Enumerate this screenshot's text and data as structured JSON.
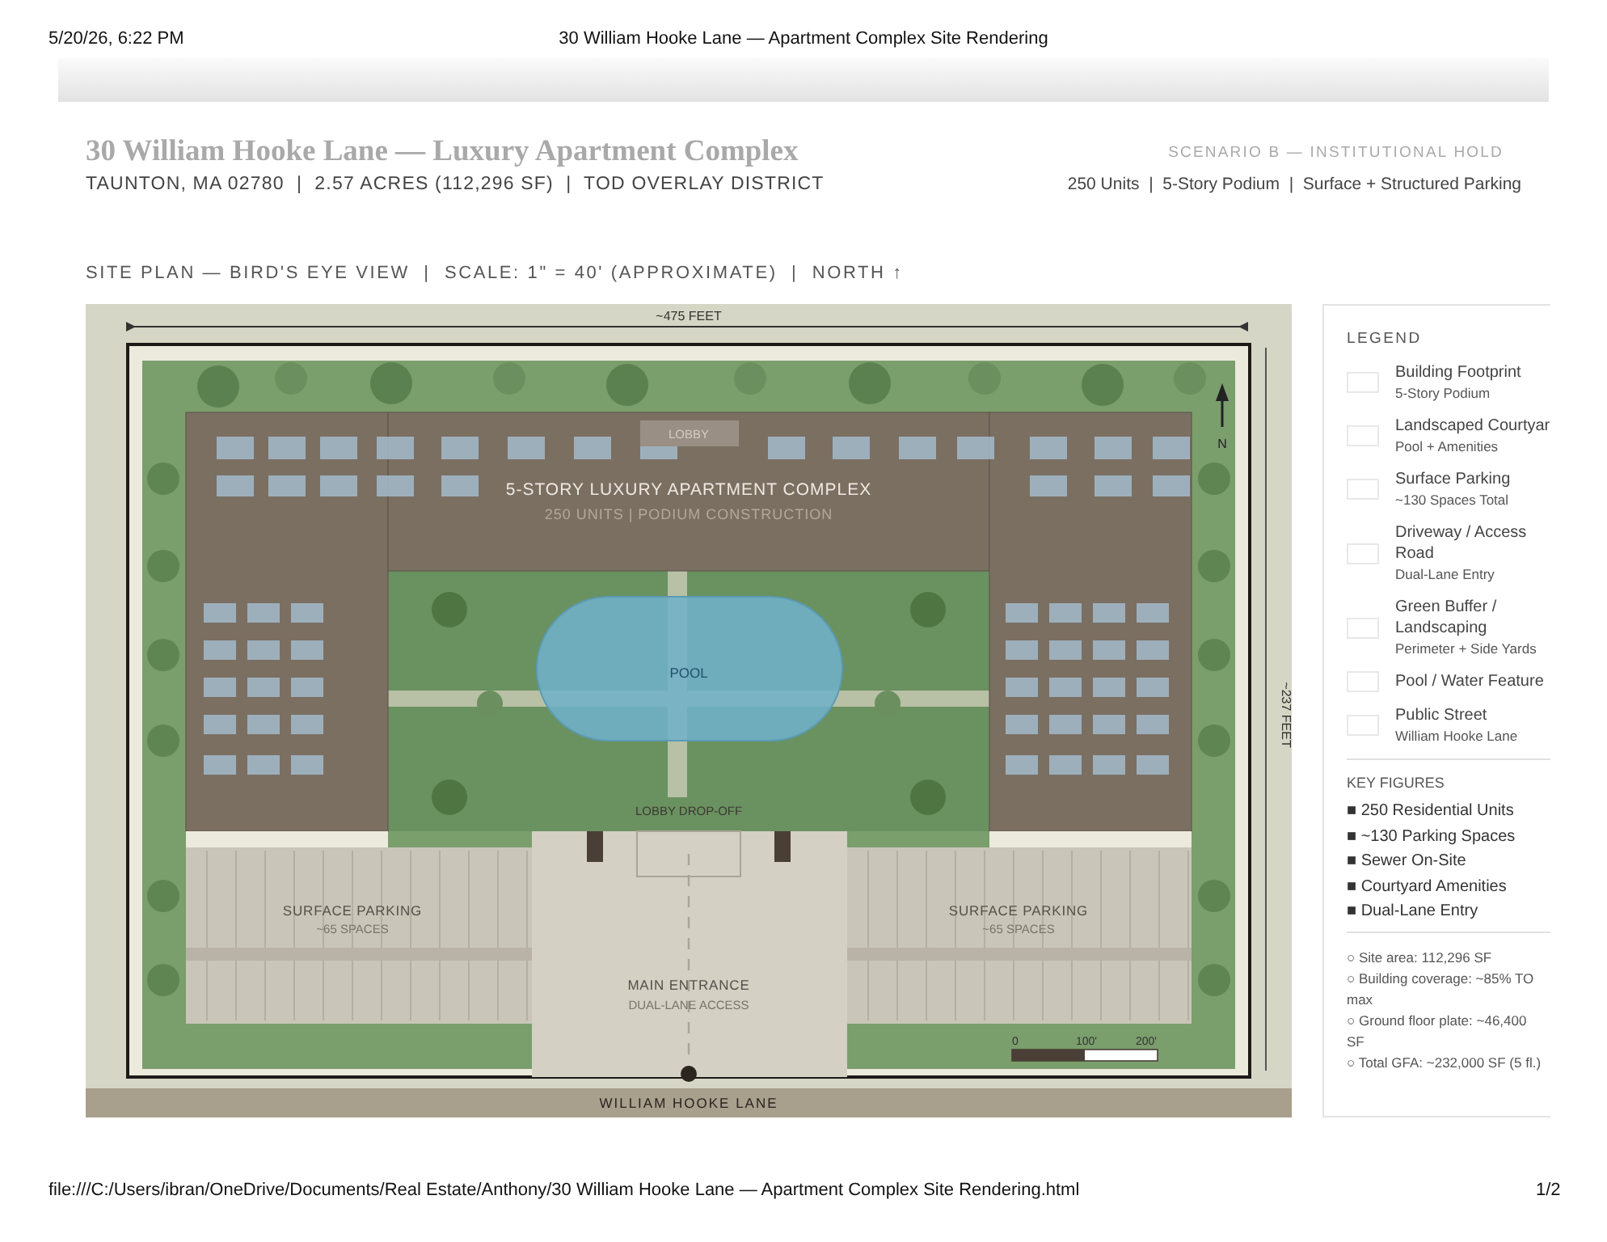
{
  "print_header": {
    "date": "5/20/26, 6:22 PM",
    "title": "30 William Hooke Lane — Apartment Complex Site Rendering"
  },
  "header": {
    "title": "30 William Hooke Lane — Luxury Apartment Complex",
    "location": "TAUNTON, MA 02780  |  2.57 ACRES (112,296 SF)  |  TOD OVERLAY DISTRICT",
    "scenario": "SCENARIO B — INSTITUTIONAL HOLD",
    "summary": "250 Units  |  5-Story Podium  |  Surface + Structured Parking"
  },
  "site_plan": {
    "caption": "SITE PLAN — BIRD'S EYE VIEW  |  SCALE: 1\" = 40' (APPROXIMATE)  |  NORTH ↑",
    "width_dimension": "~475 FEET",
    "depth_dimension": "~237 FEET",
    "north": "N",
    "building_title": "5-STORY LUXURY APARTMENT COMPLEX",
    "building_subtitle": "250 UNITS  |  PODIUM CONSTRUCTION",
    "lobby": "LOBBY",
    "pool": "POOL",
    "drop_off": "LOBBY DROP-OFF",
    "parking": [
      {
        "title": "SURFACE PARKING",
        "subtitle": "~65 SPACES"
      },
      {
        "title": "SURFACE PARKING",
        "subtitle": "~65 SPACES"
      }
    ],
    "entrance": {
      "title": "MAIN ENTRANCE",
      "subtitle": "DUAL-LANE ACCESS"
    },
    "scale_ticks": [
      "0",
      "100'",
      "200'"
    ],
    "street": "WILLIAM HOOKE LANE"
  },
  "legend": {
    "title": "LEGEND",
    "items": [
      {
        "label": "Building Footprint",
        "sublabel": "5-Story Podium"
      },
      {
        "label": "Landscaped Courtyar",
        "sublabel": "Pool + Amenities"
      },
      {
        "label": "Surface Parking",
        "sublabel": "~130 Spaces Total"
      },
      {
        "label": "Driveway / Access Road",
        "sublabel": "Dual-Lane Entry"
      },
      {
        "label": "Green Buffer / Landscaping",
        "sublabel": "Perimeter + Side Yards"
      },
      {
        "label": "Pool / Water Feature"
      },
      {
        "label": "Public Street",
        "sublabel": "William Hooke Lane"
      }
    ],
    "key_figures_title": "KEY FIGURES",
    "key_figures": [
      "■ 250 Residential Units",
      "■ ~130 Parking Spaces",
      "■ Sewer On-Site",
      "■ Courtyard Amenities",
      "■ Dual-Lane Entry"
    ],
    "stats": [
      "○ Site area: 112,296 SF",
      "○ Building coverage: ~85% TO max",
      "○ Ground floor plate: ~46,400 SF",
      "○ Total GFA: ~232,000 SF (5 fl.)"
    ]
  },
  "print_footer": {
    "url": "file:///C:/Users/ibran/OneDrive/Documents/Real Estate/Anthony/30 William Hooke Lane — Apartment Complex Site Rendering.html",
    "page": "1/2"
  }
}
